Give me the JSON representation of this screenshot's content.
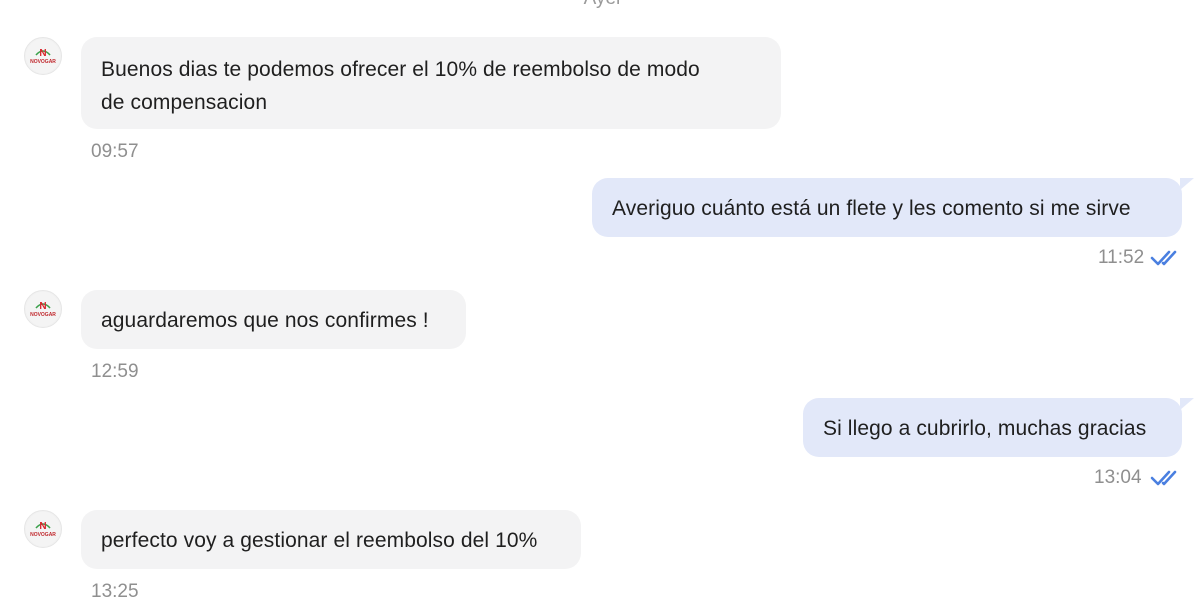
{
  "chat": {
    "day_label": "Ayer",
    "contact": {
      "avatar_text": "NOVOGAR",
      "avatar_initial": "N"
    },
    "messages": [
      {
        "direction": "incoming",
        "text": "Buenos dias te podemos ofrecer el 10% de reembolso de modo de compensacion",
        "line1": "Buenos dias te podemos ofrecer el 10% de reembolso de modo",
        "line2": "de compensacion",
        "time": "09:57"
      },
      {
        "direction": "outgoing",
        "text": "Averiguo cuánto está un flete y les comento si me sirve",
        "time": "11:52",
        "status": "read",
        "status_icon": "double-check-icon"
      },
      {
        "direction": "incoming",
        "text": "aguardaremos que nos confirmes !",
        "time": "12:59"
      },
      {
        "direction": "outgoing",
        "text": "Si llego a cubrirlo, muchas gracias",
        "time": "13:04",
        "status": "read",
        "status_icon": "double-check-icon"
      },
      {
        "direction": "incoming",
        "text": "perfecto voy a gestionar el reembolso del 10%",
        "time": "13:25"
      }
    ]
  },
  "colors": {
    "incoming_bubble": "#f3f3f4",
    "outgoing_bubble": "#e2e8f9",
    "read_ticks": "#4a7fe0",
    "brand_red": "#d9262c",
    "brand_green": "#3aa14a"
  }
}
